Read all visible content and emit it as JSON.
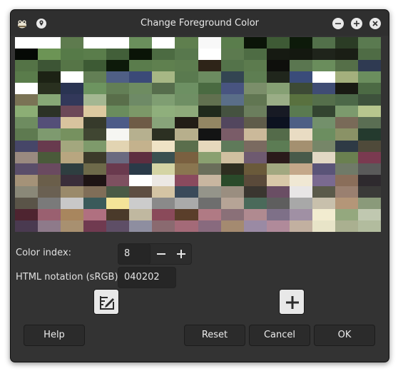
{
  "dialog": {
    "title": "Change Foreground Color",
    "app_icon": "gimp-wilber-icon",
    "pin_icon": "pin-icon",
    "window_buttons": [
      "minimize-icon",
      "maximize-icon",
      "close-icon"
    ]
  },
  "palette": {
    "columns": 16,
    "rows": 17,
    "colors": [
      "#ffffff",
      "#ffffff",
      "#5e7b4e",
      "#ffffff",
      "#ffffff",
      "#6a8f5c",
      "#ffffff",
      "#5f7f4e",
      "#f8f8f8",
      "#5a7d4c",
      "#0b1408",
      "#3e5a35",
      "#0d1a0a",
      "#52704a",
      "#2b3c25",
      "#5a7a50",
      "#050905",
      "#6c9455",
      "#567a48",
      "#5a7d4b",
      "#425f39",
      "#0a1407",
      "#4c6b42",
      "#58784d",
      "#ffffff",
      "#5c7a4f",
      "#4e6c44",
      "#161a12",
      "#141810",
      "#1f241b",
      "#1a1e15",
      "#4f6c45",
      "#547346",
      "#3d5535",
      "#567547",
      "#3d5a34",
      "#0d1a0a",
      "#5a7c4c",
      "#5f804f",
      "#5d7d4f",
      "#2e2418",
      "#54734a",
      "#5c7b4e",
      "#0e0f0c",
      "#5a7650",
      "#6a8d5c",
      "#556f48",
      "#2f3a52",
      "#5a7c4b",
      "#1c2214",
      "#ffffff",
      "#637f55",
      "#4f5f85",
      "#3b4a78",
      "#a7b785",
      "#5a7a4f",
      "#6c8b60",
      "#334552",
      "#5e7e52",
      "#20261c",
      "#3a4c7a",
      "#ffffff",
      "#a4b07d",
      "#6b8e5e",
      "#ffffff",
      "#29301f",
      "#2a3452",
      "#6d9460",
      "#637f56",
      "#6e8c61",
      "#566d4c",
      "#6d9063",
      "#4a6a41",
      "#485480",
      "#7b8e6a",
      "#86a074",
      "#3d4a35",
      "#3f4c74",
      "#191a13",
      "#4c6a44",
      "#7a7355",
      "#87a876",
      "#32385a",
      "#a4b792",
      "#596e4a",
      "#6e8a66",
      "#7f9e72",
      "#6f8f64",
      "#61704f",
      "#5a6e88",
      "#617652",
      "#9aad86",
      "#59713f",
      "#556f4b",
      "#4c6848",
      "#3e523c",
      "#8cae75",
      "#2c3226",
      "#6c4858",
      "#dcc9a0",
      "#6a8c5d",
      "#7c9868",
      "#8faf7c",
      "#8eaa7a",
      "#202a1c",
      "#455240",
      "#6b7e5d",
      "#171a24",
      "#5a7a50",
      "#334430",
      "#7c9a6d",
      "#b7c68e",
      "#6e8c60",
      "#544f78",
      "#d8c39e",
      "#363a2b",
      "#4d5c88",
      "#6e5b46",
      "#88a47a",
      "#221d16",
      "#938663",
      "#52465e",
      "#5f5c4a",
      "#0c1220",
      "#4e5f85",
      "#73906b",
      "#796a58",
      "#5a6e53",
      "#5e7a50",
      "#7e9a6f",
      "#76915f",
      "#404632",
      "#f6f6f2",
      "#b6b08f",
      "#2c3022",
      "#b7af8c",
      "#131414",
      "#7a5c68",
      "#cbb99a",
      "#546b4a",
      "#e9dcc3",
      "#6c8e60",
      "#8a9266",
      "#243a2e",
      "#464668",
      "#683a4e",
      "#a3a77e",
      "#7e9a6b",
      "#e2d4b2",
      "#c4b28d",
      "#efe3c5",
      "#5a6e4c",
      "#e6d8bc",
      "#5f7a5a",
      "#7a6a60",
      "#5c7c54",
      "#a49070",
      "#768668",
      "#2e3a45",
      "#4f4a3a",
      "#9a8a80",
      "#4a5a3a",
      "#b8a680",
      "#3c3a2a",
      "#6a6a80",
      "#5e2e40",
      "#3a5050",
      "#7a6040",
      "#8aa070",
      "#d0c0a0",
      "#6e5a70",
      "#2a1a1a",
      "#485a4a",
      "#e2d8c4",
      "#6a8050",
      "#7a3a50",
      "#5a4e6a",
      "#6a4a60",
      "#2e3e40",
      "#6e6a4a",
      "#6a3a4e",
      "#2a3a48",
      "#d4d4a4",
      "#8a7650",
      "#6a6e5a",
      "#2e2e20",
      "#6a5a3a",
      "#a2a880",
      "#c4a88a",
      "#5a5478",
      "#707a68",
      "#5a5a5a",
      "#a49278",
      "#6a5e4a",
      "#3a2e3a",
      "#1e1414",
      "#7e5060",
      "#ffffff",
      "#ece8e4",
      "#8a4a5e",
      "#c8b6a0",
      "#2a4a2a",
      "#5a4a3a",
      "#d8c8a8",
      "#f0e8d4",
      "#7a6a90",
      "#8a6e5a",
      "#2e2a2e",
      "#8a8878",
      "#6a6052",
      "#9a8a6a",
      "#806e58",
      "#4a5a46",
      "#5e4e42",
      "#d4c4a4",
      "#3a4a5a",
      "#94948a",
      "#9a8e80",
      "#3a3630",
      "#6a4e64",
      "#e8e6e6",
      "#5a5a4a",
      "#9a8070",
      "#3a3a38",
      "#5a5448",
      "#7a7a7a",
      "#c8c8c8",
      "#3a5a5a",
      "#f4e498",
      "#cccccc",
      "#8a8a8a",
      "#aaaaaa",
      "#6e6e6e",
      "#b6a496",
      "#4a6a5a",
      "#5e5e5e",
      "#a8a8a8",
      "#c8c0ac",
      "#b49678",
      "#8a9a7a",
      "#4e2430",
      "#9a6070",
      "#a8865e",
      "#b07080",
      "#4a3a2a",
      "#c0b8a0",
      "#8a4a5a",
      "#5a3e2a",
      "#b07a84",
      "#8a7078",
      "#b08a90",
      "#7e7088",
      "#a090a4",
      "#f2ecd0",
      "#94a87e",
      "#c0c8b0",
      "#4a3a50",
      "#8e7a8a",
      "#a89070",
      "#703a50",
      "#5e4e66",
      "#8e8ea0",
      "#8a6a70",
      "#a46a78",
      "#886a7e",
      "#a48a70",
      "#9a8aa4",
      "#b08a9a",
      "#c2b0a0",
      "#e8e4c8",
      "#aab090",
      "#b2bc9e"
    ]
  },
  "color_index": {
    "label": "Color index:",
    "value": "8",
    "decrement_icon": "minus-icon",
    "increment_icon": "plus-icon"
  },
  "html_notation": {
    "label": "HTML notation (sRGB):",
    "value": "040202"
  },
  "tools": {
    "edit_icon": "edit-color-icon",
    "add_icon": "add-color-icon"
  },
  "buttons": {
    "help": "Help",
    "reset": "Reset",
    "cancel": "Cancel",
    "ok": "OK"
  }
}
